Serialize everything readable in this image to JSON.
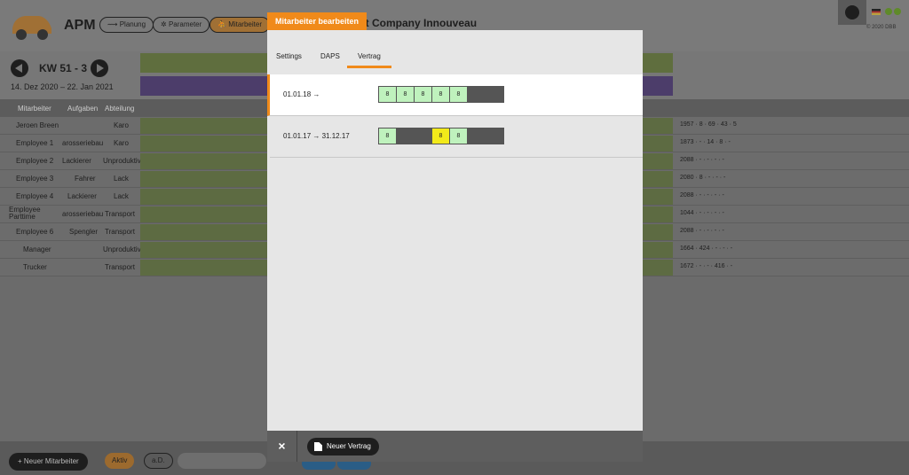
{
  "app": {
    "name": "APM",
    "company": "st Company Innouveau",
    "copyright": "© 2020 DBB",
    "nav": [
      {
        "label": "Planung",
        "icon": "planning-icon"
      },
      {
        "label": "Parameter",
        "icon": "gear-icon"
      },
      {
        "label": "Mitarbeiter",
        "icon": "employee-icon"
      }
    ]
  },
  "week": {
    "label": "KW 51 - 3",
    "range": "14. Dez 2020 – 22. Jan 2021",
    "row_k": "K",
    "row_l": "L"
  },
  "columns": {
    "employee": "Mitarbeiter",
    "tasks": "Aufgaben",
    "department": "Abteilung"
  },
  "employees": [
    {
      "name": "Jeroen Breen",
      "task": "",
      "dept": "Karo",
      "stats": "1957 · 8 · 69 · 43 · 5"
    },
    {
      "name": "Employee 1",
      "task": "arosseriebau",
      "dept": "Karo",
      "stats": "1873 · - · 14 · 8 · -"
    },
    {
      "name": "Employee 2",
      "task": "Lackierer",
      "dept": "Unproduktiv",
      "stats": "2088 · - · - · - · -"
    },
    {
      "name": "Employee 3",
      "task": "Fahrer",
      "dept": "Lack",
      "stats": "2080 · 8 · - · - · -"
    },
    {
      "name": "Employee 4",
      "task": "Lackierer",
      "dept": "Lack",
      "stats": "2088 · - · - · - · -"
    },
    {
      "name": "Employee Parttime",
      "task": "arosseriebau",
      "dept": "Transport",
      "stats": "1044 · - · - · - · -"
    },
    {
      "name": "Employee 6",
      "task": "Spengler",
      "dept": "Transport",
      "stats": "2088 · - · - · - · -"
    },
    {
      "name": "Manager",
      "task": "",
      "dept": "Unproduktiv",
      "stats": "1664 · 424 · - · - · -"
    },
    {
      "name": "Trucker",
      "task": "",
      "dept": "Transport",
      "stats": "1672 · - · - · 416 · -"
    }
  ],
  "footer": {
    "new_employee": "+ Neuer Mitarbeiter",
    "active": "Aktiv",
    "ad": "a.D."
  },
  "modal": {
    "title": "Mitarbeiter bearbeiten",
    "tabs": [
      "Settings",
      "DAPS",
      "Vertrag"
    ],
    "active_tab": "Vertrag",
    "contracts": [
      {
        "period": "01.01.18 →",
        "days": [
          {
            "v": "8",
            "t": "g"
          },
          {
            "v": "8",
            "t": "g"
          },
          {
            "v": "8",
            "t": "g"
          },
          {
            "v": "8",
            "t": "g"
          },
          {
            "v": "8",
            "t": "g"
          },
          {
            "v": "",
            "t": "x"
          },
          {
            "v": "",
            "t": "x"
          }
        ]
      },
      {
        "period": "01.01.17 → 31.12.17",
        "days": [
          {
            "v": "8",
            "t": "g"
          },
          {
            "v": "",
            "t": "x"
          },
          {
            "v": "",
            "t": "x"
          },
          {
            "v": "8",
            "t": "y"
          },
          {
            "v": "8",
            "t": "g"
          },
          {
            "v": "",
            "t": "x"
          },
          {
            "v": "",
            "t": "x"
          }
        ]
      }
    ],
    "close_label": "×",
    "new_contract": "Neuer Vertrag"
  },
  "colors": {
    "accent": "#f08a1a",
    "day_green": "#bff2bd",
    "day_yellow": "#f2ea1a",
    "day_off": "#555555"
  }
}
